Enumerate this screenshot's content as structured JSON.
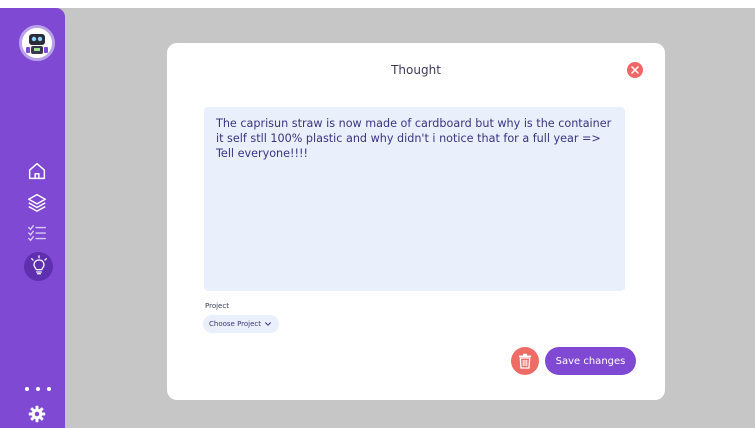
{
  "colors": {
    "sidebar": "#7f49d3",
    "sidebar_active": "#5e2fae",
    "backdrop": "#c6c6c6",
    "modal_bg": "#ffffff",
    "textarea_bg": "#eaeffc",
    "accent": "#7f49d3",
    "danger": "#ee6b66"
  },
  "sidebar": {
    "avatar_icon": "robot-avatar-icon",
    "items": [
      {
        "icon": "home-icon",
        "active": false
      },
      {
        "icon": "layers-icon",
        "active": false
      },
      {
        "icon": "checklist-icon",
        "active": false
      },
      {
        "icon": "lightbulb-icon",
        "active": true
      }
    ],
    "more_icon": "more-dots-icon",
    "settings_icon": "gear-icon"
  },
  "modal": {
    "title": "Thought",
    "close_icon": "close-icon",
    "note_text": "The caprisun straw is now made of cardboard but why is the container it self stll 100% plastic and why didn't i notice that for a full year => Tell everyone!!!!",
    "project_label": "Project",
    "project_select_value": "Choose Project",
    "delete_icon": "trash-icon",
    "save_label": "Save changes"
  }
}
